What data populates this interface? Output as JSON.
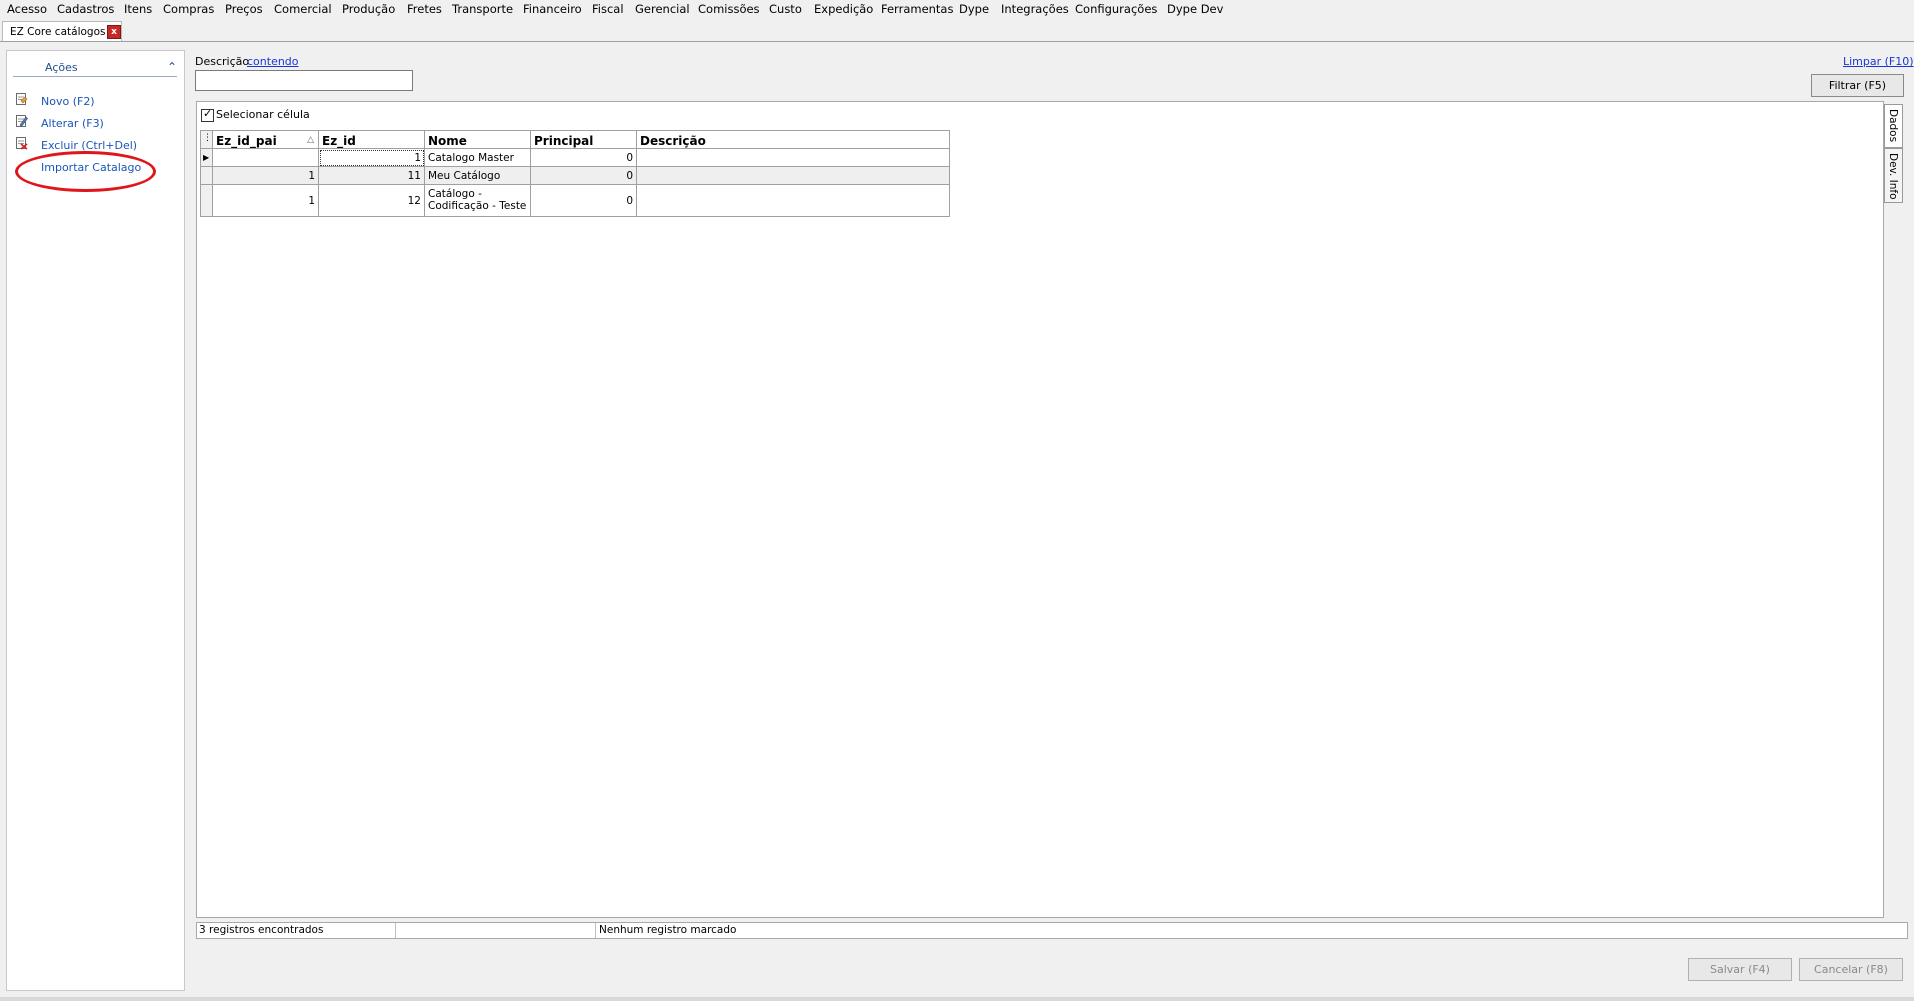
{
  "menu": [
    "Acesso",
    "Cadastros",
    "Itens",
    "Compras",
    "Preços",
    "Comercial",
    "Produção",
    "Fretes",
    "Transporte",
    "Financeiro",
    "Fiscal",
    "Gerencial",
    "Comissões",
    "Custo",
    "Expedição",
    "Ferramentas",
    "Dype",
    "Integrações",
    "Configurações",
    "Dype Dev"
  ],
  "document_tab": {
    "title": "EZ Core catálogos",
    "close": "x"
  },
  "actions_panel": {
    "header": "Ações",
    "chevron": "^",
    "items": [
      {
        "label": "Novo (F2)",
        "icon": "new-document-icon"
      },
      {
        "label": "Alterar (F3)",
        "icon": "edit-document-icon"
      },
      {
        "label": "Excluir (Ctrl+Del)",
        "icon": "delete-document-icon"
      },
      {
        "label": "Importar Catalago",
        "icon": ""
      }
    ],
    "highlight_color": "#e0161b"
  },
  "filter": {
    "descricao_label": "Descrição",
    "descricao_mode": "contendo",
    "descricao_value": "",
    "limpar_label": "Limpar (F10)",
    "filtrar_label": "Filtrar (F5)"
  },
  "grid": {
    "select_cell_label": "Selecionar célula",
    "select_cell_checked": true,
    "columns": [
      "Ez_id_pai",
      "Ez_id",
      "Nome",
      "Principal",
      "Descrição"
    ],
    "sort_indicator": "△",
    "rows": [
      {
        "ez_id_pai": "",
        "ez_id": "1",
        "nome": "Catalogo Master",
        "principal": "0",
        "descricao": ""
      },
      {
        "ez_id_pai": "1",
        "ez_id": "11",
        "nome": "Meu Catálogo",
        "principal": "0",
        "descricao": ""
      },
      {
        "ez_id_pai": "1",
        "ez_id": "12",
        "nome": "Catálogo - Codificação - Teste",
        "principal": "0",
        "descricao": ""
      }
    ]
  },
  "side_tabs": [
    "Dados",
    "Dev. Info"
  ],
  "status": {
    "count": "3 registros encontrados",
    "middle": "",
    "marked": "Nenhum registro marcado"
  },
  "footer": {
    "salvar_label": "Salvar (F4)",
    "cancelar_label": "Cancelar (F8)"
  }
}
